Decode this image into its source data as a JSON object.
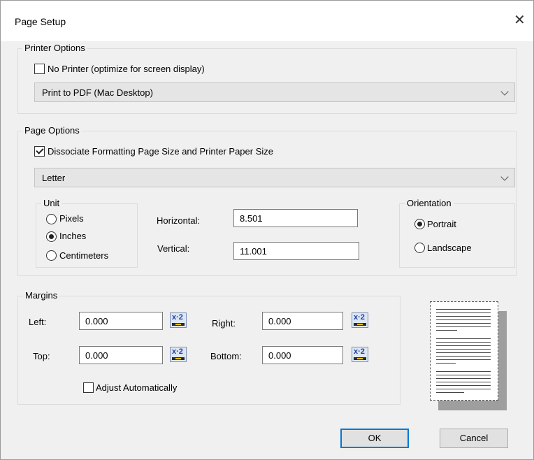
{
  "dialog": {
    "title": "Page Setup"
  },
  "printer_options": {
    "group_label": "Printer Options",
    "no_printer": {
      "label": "No Printer (optimize for screen display)",
      "checked": false
    },
    "printer_select": {
      "value": "Print to PDF (Mac Desktop)"
    }
  },
  "page_options": {
    "group_label": "Page Options",
    "dissociate": {
      "label": "Dissociate Formatting Page Size and Printer Paper Size",
      "checked": true
    },
    "paper_select": {
      "value": "Letter"
    },
    "unit": {
      "group_label": "Unit",
      "options": [
        {
          "label": "Pixels",
          "selected": false
        },
        {
          "label": "Inches",
          "selected": true
        },
        {
          "label": "Centimeters",
          "selected": false
        }
      ]
    },
    "horizontal": {
      "label": "Horizontal:",
      "value": "8.501"
    },
    "vertical": {
      "label": "Vertical:",
      "value": "11.001"
    },
    "orientation": {
      "group_label": "Orientation",
      "options": [
        {
          "label": "Portrait",
          "selected": true
        },
        {
          "label": "Landscape",
          "selected": false
        }
      ]
    }
  },
  "margins": {
    "group_label": "Margins",
    "left": {
      "label": "Left:",
      "value": "0.000"
    },
    "right": {
      "label": "Right:",
      "value": "0.000"
    },
    "top": {
      "label": "Top:",
      "value": "0.000"
    },
    "bottom": {
      "label": "Bottom:",
      "value": "0.000"
    },
    "calc_icon_text": "x·2",
    "adjust": {
      "label": "Adjust Automatically",
      "checked": false
    }
  },
  "buttons": {
    "ok": "OK",
    "cancel": "Cancel"
  },
  "colors": {
    "default_button_border": "#0078d7",
    "dialog_bg": "#f0f0f0"
  }
}
